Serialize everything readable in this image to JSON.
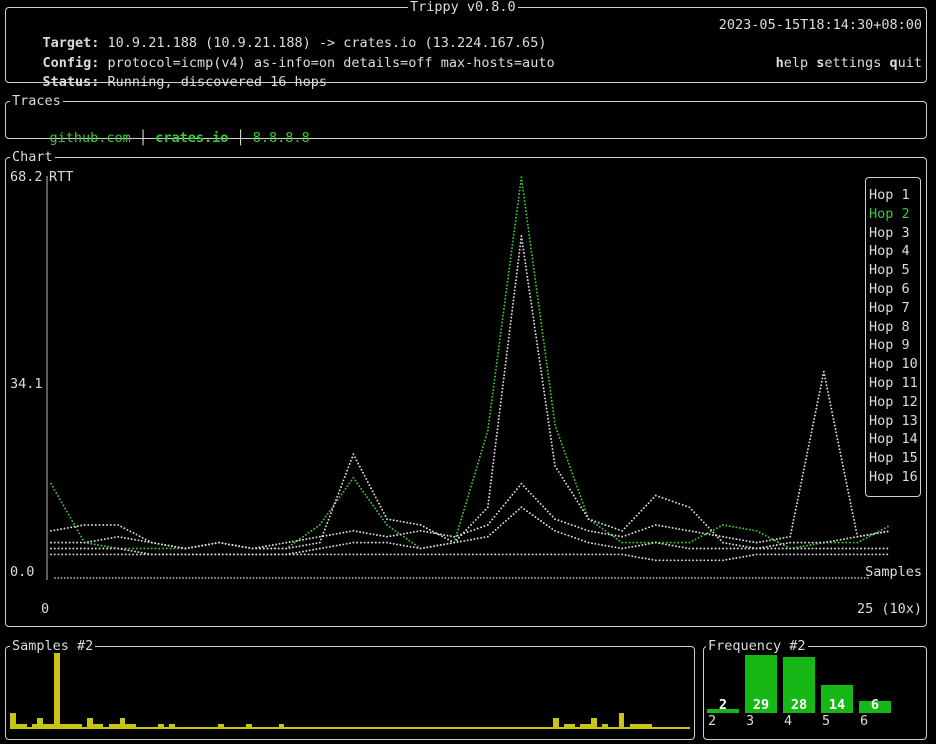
{
  "header": {
    "title": "Trippy v0.8.0",
    "target_label": "Target:",
    "target_value": " 10.9.21.188 (10.9.21.188) -> crates.io (13.224.167.65)",
    "config_label": "Config:",
    "config_value": " protocol=icmp(v4) as-info=on details=off max-hosts=auto",
    "status_label": "Status:",
    "status_value": " Running, discovered 16 hops",
    "timestamp": "2023-05-15T18:14:30+08:00",
    "help_key": "h",
    "help_rest": "elp",
    "settings_key": "s",
    "settings_rest": "ettings",
    "quit_key": "q",
    "quit_rest": "uit"
  },
  "traces": {
    "title": "Traces",
    "tabs": [
      {
        "label": "github.com",
        "selected": false
      },
      {
        "label": "crates.io",
        "selected": true
      },
      {
        "label": "8.8.8.8",
        "selected": false
      }
    ]
  },
  "chart": {
    "title": "Chart",
    "y_top": "68.2",
    "y_mid": "34.1",
    "y_zero": "0.0",
    "y_axis_name": "RTT",
    "x_axis_name": "Samples",
    "x_start": "0",
    "x_end": "25 (10x)",
    "legend": [
      "Hop 1",
      "Hop 2",
      "Hop 3",
      "Hop 4",
      "Hop 5",
      "Hop 6",
      "Hop 7",
      "Hop 8",
      "Hop 9",
      "Hop 10",
      "Hop 11",
      "Hop 12",
      "Hop 13",
      "Hop 14",
      "Hop 15",
      "Hop 16"
    ],
    "highlight_hop_index": 1,
    "colors": {
      "highlight": "#39c936",
      "normal": "#dcdcdc"
    }
  },
  "chart_data": {
    "type": "line",
    "title": "",
    "ylabel": "RTT",
    "xlabel": "Samples",
    "xlim": [
      0,
      25
    ],
    "ylim": [
      0,
      68.2
    ],
    "x": [
      0,
      1,
      2,
      3,
      4,
      5,
      6,
      7,
      8,
      9,
      10,
      11,
      12,
      13,
      14,
      15,
      16,
      17,
      18,
      19,
      20,
      21,
      22,
      23,
      24,
      25
    ],
    "series": [
      {
        "name": "Hop 2",
        "values": [
          16,
          6,
          5,
          5,
          5,
          6,
          5,
          5,
          9,
          17,
          9,
          5,
          6,
          25,
          68,
          26,
          10,
          6,
          6,
          6,
          9,
          8,
          5,
          6,
          6,
          9
        ]
      },
      {
        "name": "Hop 5",
        "values": [
          8,
          9,
          9,
          6,
          5,
          6,
          5,
          5,
          6,
          21,
          10,
          9,
          6,
          12,
          58,
          19,
          10,
          8,
          14,
          12,
          6,
          5,
          6,
          6,
          7,
          8
        ]
      },
      {
        "name": "Hop 9",
        "values": [
          5,
          5,
          5,
          4,
          4,
          4,
          4,
          4,
          5,
          6,
          6,
          5,
          6,
          7,
          12,
          8,
          6,
          5,
          6,
          5,
          5,
          5,
          5,
          5,
          5,
          5
        ]
      },
      {
        "name": "Hop 12",
        "values": [
          4,
          4,
          4,
          4,
          4,
          4,
          4,
          4,
          4,
          4,
          4,
          4,
          4,
          4,
          4,
          4,
          4,
          4,
          3,
          3,
          3,
          4,
          4,
          4,
          4,
          4
        ]
      },
      {
        "name": "Hop 16",
        "values": [
          6,
          6,
          7,
          6,
          5,
          6,
          5,
          6,
          7,
          8,
          7,
          8,
          7,
          9,
          16,
          10,
          8,
          7,
          9,
          8,
          7,
          6,
          7,
          35,
          7,
          8
        ]
      }
    ]
  },
  "samples": {
    "title": "Samples #2",
    "values": [
      3,
      1,
      1,
      0,
      1,
      2,
      1,
      1,
      14,
      1,
      1,
      1,
      1,
      0,
      2,
      1,
      1,
      0,
      1,
      1,
      2,
      1,
      1,
      0,
      0,
      0,
      0,
      1,
      0,
      1,
      0,
      0,
      0,
      0,
      0,
      0,
      0,
      0,
      1,
      0,
      0,
      0,
      0,
      1,
      0,
      0,
      0,
      0,
      0,
      1,
      0,
      0,
      0,
      0,
      0,
      0,
      0,
      0,
      0,
      0,
      0,
      0,
      0,
      0,
      0,
      0,
      0,
      0,
      0,
      0,
      0,
      0,
      0,
      0,
      0,
      0,
      0,
      0,
      0,
      0,
      0,
      0,
      0,
      0,
      0,
      0,
      0,
      0,
      0,
      0,
      0,
      0,
      0,
      0,
      0,
      0,
      0,
      0,
      0,
      2,
      0,
      1,
      1,
      0,
      1,
      1,
      2,
      0,
      1,
      0,
      0,
      3,
      0,
      1,
      1,
      1,
      1,
      0,
      0,
      0,
      0,
      0,
      0,
      0
    ],
    "color": "#c8c414"
  },
  "frequency": {
    "title": "Frequency #2",
    "bars": [
      {
        "key": "2",
        "value": 2
      },
      {
        "key": "3",
        "value": 29
      },
      {
        "key": "4",
        "value": 28
      },
      {
        "key": "5",
        "value": 14
      },
      {
        "key": "6",
        "value": 6
      }
    ],
    "color": "#15b815"
  }
}
